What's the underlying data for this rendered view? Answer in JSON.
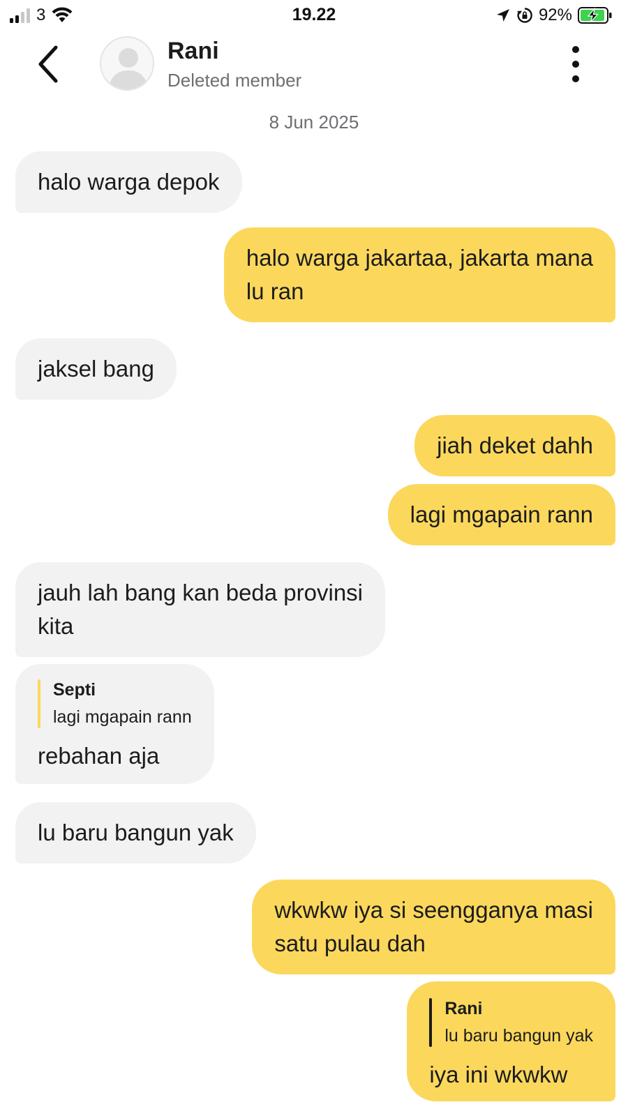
{
  "status_bar": {
    "carrier": "3",
    "time": "19.22",
    "battery_percent": "92%",
    "icons": [
      "signal-bars-icon",
      "wifi-icon",
      "location-arrow-icon",
      "rotation-lock-icon",
      "battery-charging-icon"
    ]
  },
  "header": {
    "name": "Rani",
    "subtitle": "Deleted member",
    "icons": [
      "chevron-left-icon",
      "avatar-placeholder",
      "more-vertical-icon"
    ]
  },
  "date_separator": "8 Jun 2025",
  "colors": {
    "incoming_bubble": "#f2f2f2",
    "outgoing_bubble": "#fbd85c",
    "quote_bar_incoming": "#fbd85c",
    "quote_bar_outgoing": "#1c1c1e",
    "battery_charging": "#3dd34f"
  },
  "messages": [
    {
      "direction": "incoming",
      "text": "halo warga depok"
    },
    {
      "direction": "outgoing",
      "text": "halo warga jakartaa, jakarta mana\nlu ran"
    },
    {
      "direction": "incoming",
      "text": "jaksel bang"
    },
    {
      "direction": "outgoing",
      "text": "jiah deket dahh"
    },
    {
      "direction": "outgoing",
      "text": "lagi mgapain rann"
    },
    {
      "direction": "incoming",
      "text": "jauh lah bang kan beda provinsi\nkita"
    },
    {
      "direction": "incoming",
      "text": "rebahan aja",
      "reply_to": {
        "name": "Septi",
        "text": "lagi mgapain rann"
      }
    },
    {
      "direction": "incoming",
      "text": "lu baru bangun yak"
    },
    {
      "direction": "outgoing",
      "text": "wkwkw iya si seengganya masi\nsatu pulau dah"
    },
    {
      "direction": "outgoing",
      "text": "iya ini wkwkw",
      "reply_to": {
        "name": "Rani",
        "text": "lu baru bangun yak"
      }
    }
  ]
}
